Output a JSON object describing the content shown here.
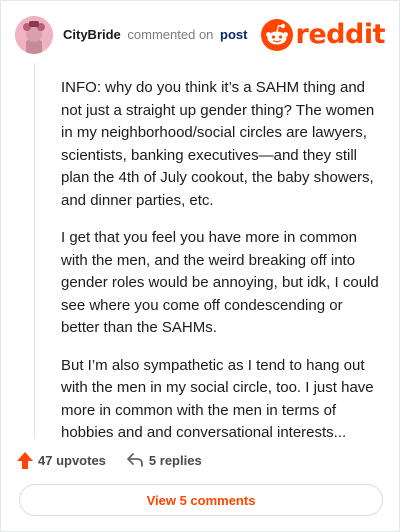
{
  "comment": {
    "username": "CityBride",
    "action_text": "commented on",
    "post_link": "post",
    "paragraphs": [
      "INFO: why do you think it’s a SAHM thing and not just a straight up gender thing? The women in my neighborhood/social circles are lawyers, scientists, banking executives—and they still plan the 4th of July cookout, the baby showers, and dinner parties, etc.",
      "I get that you feel you have more in common with the men, and the weird breaking off into gender roles would be annoying, but idk, I could see where you come off condescending or better than the SAHMs.",
      "But I’m also sympathetic as I tend to hang out with the men in my social circle, too. I just have more in common with the men in terms of hobbies and and conversational interests..."
    ]
  },
  "brand": {
    "wordmark": "reddit",
    "color": "#ff4500"
  },
  "footer": {
    "upvotes": "47 upvotes",
    "replies": "5 replies",
    "view_comments": "View 5 comments"
  },
  "colors": {
    "accent": "#ff4500",
    "avatar_bg": "#efb3c2",
    "link": "#0a2a66"
  },
  "icons": [
    "avatar",
    "reddit-logo-icon",
    "upvote-arrow-icon",
    "reply-arrow-icon"
  ]
}
